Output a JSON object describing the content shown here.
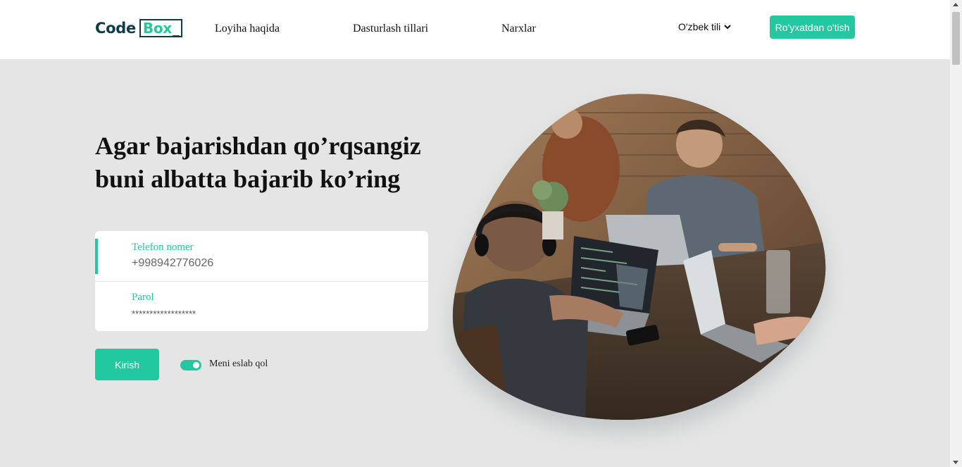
{
  "brand": {
    "logo_word": "Code",
    "logo_box": "Box",
    "logo_cursor": "_"
  },
  "nav": {
    "links": [
      "Loyiha haqida",
      "Dasturlash tillari",
      "Narxlar"
    ],
    "language": "O'zbek tili",
    "register_label": "Ro'yxatdan o'tish"
  },
  "hero": {
    "title_line1": "Agar bajarishdan qo’rqsangiz",
    "title_line2": "buni albatta bajarib ko’ring"
  },
  "form": {
    "phone_label": "Telefon nomer",
    "phone_value": "+998942776026",
    "password_label": "Parol",
    "password_value": "******************"
  },
  "actions": {
    "login_label": "Kirish",
    "remember_label": "Meni eslab qol",
    "remember_on": true
  },
  "colors": {
    "accent": "#22c9a0",
    "brand_dark": "#123a48",
    "background": "#e5e5e5"
  },
  "icons": {
    "language_caret": "chevron-down-icon",
    "hero_image": "people-coding-photo"
  }
}
